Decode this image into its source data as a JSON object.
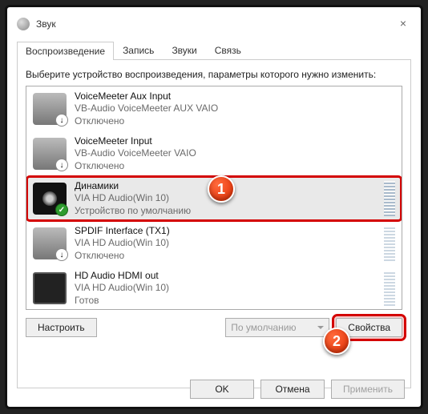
{
  "window": {
    "title": "Звук",
    "close": "×"
  },
  "tabs": {
    "playback": "Воспроизведение",
    "record": "Запись",
    "sounds": "Звуки",
    "comm": "Связь"
  },
  "instruction": "Выберите устройство воспроизведения, параметры которого нужно изменить:",
  "devices": [
    {
      "name": "VoiceMeeter Aux Input",
      "sub": "VB-Audio VoiceMeeter AUX VAIO",
      "status": "Отключено",
      "badge": "down"
    },
    {
      "name": "VoiceMeeter Input",
      "sub": "VB-Audio VoiceMeeter VAIO",
      "status": "Отключено",
      "badge": "down"
    },
    {
      "name": "Динамики",
      "sub": "VIA HD Audio(Win 10)",
      "status": "Устройство по умолчанию",
      "badge": "ok",
      "selected": true
    },
    {
      "name": "SPDIF Interface (TX1)",
      "sub": "VIA HD Audio(Win 10)",
      "status": "Отключено",
      "badge": "down"
    },
    {
      "name": "HD Audio HDMI out",
      "sub": "VIA HD Audio(Win 10)",
      "status": "Готов",
      "badge": ""
    }
  ],
  "buttons": {
    "configure": "Настроить",
    "default_combo": "По умолчанию",
    "properties": "Свойства",
    "ok": "OK",
    "cancel": "Отмена",
    "apply": "Применить"
  },
  "callouts": {
    "one": "1",
    "two": "2"
  }
}
